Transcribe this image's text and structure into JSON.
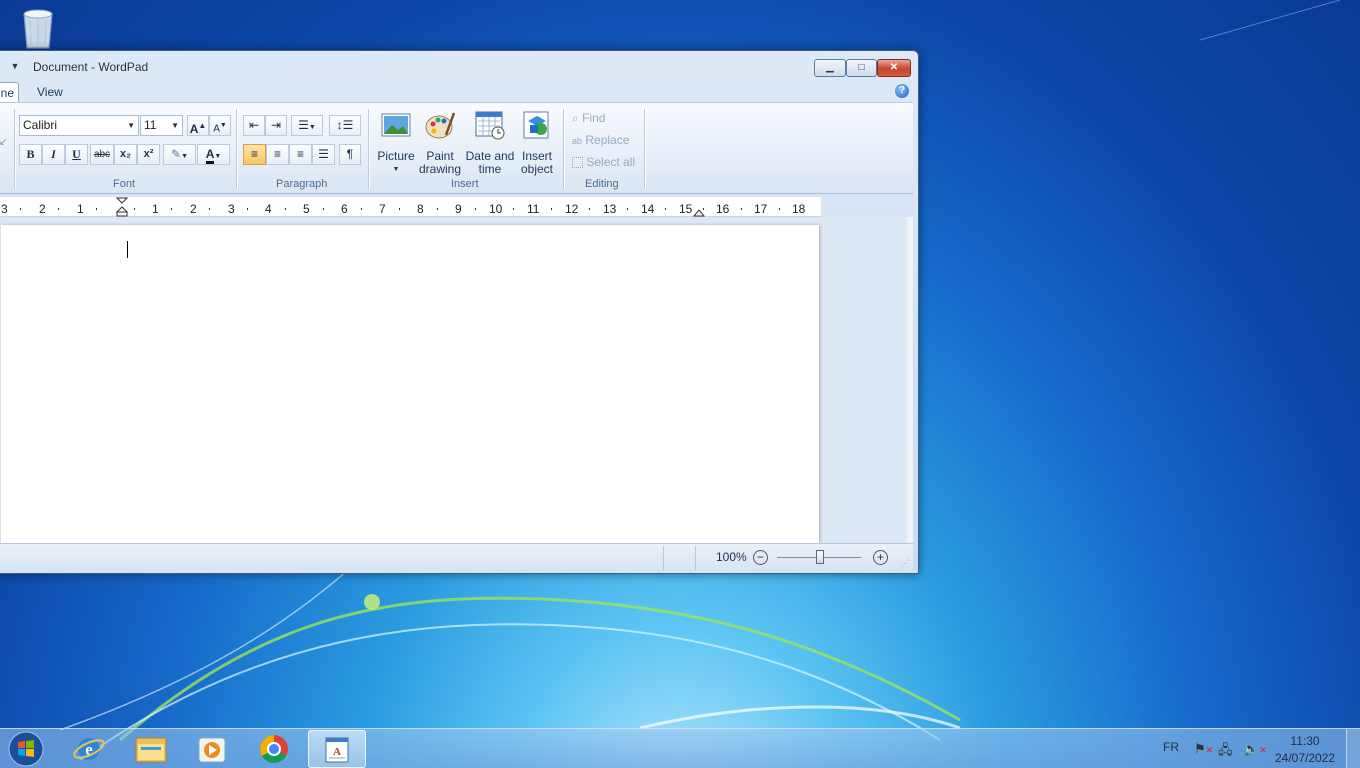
{
  "window": {
    "title": "Document - WordPad"
  },
  "tabs": {
    "home": "ne",
    "view": "View"
  },
  "font": {
    "name": "Calibri",
    "size": "11",
    "bold": "B",
    "italic": "I",
    "underline": "U",
    "strikethrough": "abc",
    "subscript": "x₂",
    "superscript": "x²",
    "group_label": "Font"
  },
  "paragraph": {
    "group_label": "Paragraph"
  },
  "insert": {
    "picture_label": "Picture",
    "paint_drawing_line1": "Paint",
    "paint_drawing_line2": "drawing",
    "date_time_line1": "Date and",
    "date_time_line2": "time",
    "insert_object_line1": "Insert",
    "insert_object_line2": "object",
    "group_label": "Insert"
  },
  "editing": {
    "find": "Find",
    "replace": "Replace",
    "select_all": "Select all",
    "group_label": "Editing"
  },
  "ruler": {
    "ticks": [
      "3",
      "2",
      "1",
      "1",
      "2",
      "3",
      "4",
      "5",
      "6",
      "7",
      "8",
      "9",
      "10",
      "11",
      "12",
      "13",
      "14",
      "15",
      "16",
      "17",
      "18"
    ]
  },
  "status": {
    "zoom": "100%"
  },
  "taskbar": {
    "language": "FR",
    "time": "11:30",
    "date": "24/07/2022"
  },
  "icons": {
    "recycle_bin": "recycle-bin-icon",
    "start": "windows-start-icon",
    "ie": "internet-explorer-icon",
    "explorer": "file-explorer-icon",
    "media": "media-player-icon",
    "chrome": "chrome-icon",
    "wordpad": "wordpad-icon"
  },
  "colors": {
    "accent": "#f9c760",
    "desktop": "#1668c9",
    "font_color": "#c00000"
  }
}
